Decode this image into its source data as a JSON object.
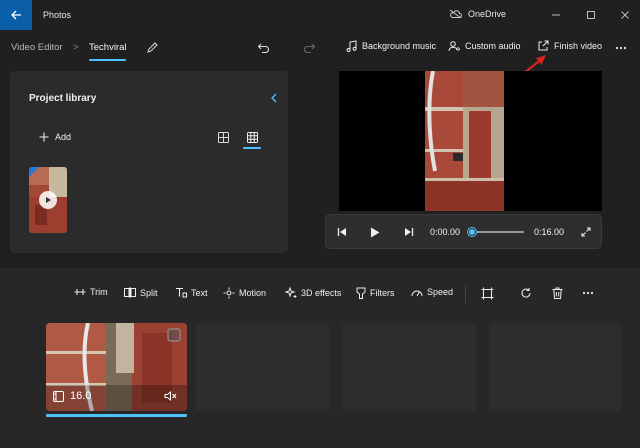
{
  "app": {
    "title": "Photos",
    "cloud_label": "OneDrive"
  },
  "breadcrumb": {
    "root": "Video Editor",
    "separator": ">",
    "current": "Techviral"
  },
  "top_actions": {
    "background_music": "Background music",
    "custom_audio": "Custom audio",
    "finish_video": "Finish video"
  },
  "library": {
    "title": "Project library",
    "add_label": "Add"
  },
  "player": {
    "current_time": "0:00.00",
    "total_time": "0:16.00",
    "progress": 0.0
  },
  "timeline_tools": {
    "trim": "Trim",
    "split": "Split",
    "text": "Text",
    "motion": "Motion",
    "effects_3d": "3D effects",
    "filters": "Filters",
    "speed": "Speed"
  },
  "clip": {
    "duration": "16.0"
  },
  "colors": {
    "accent": "#4cc2ff",
    "titlebar_back": "#0a5fa8",
    "annotation_arrow": "#d9251d"
  }
}
